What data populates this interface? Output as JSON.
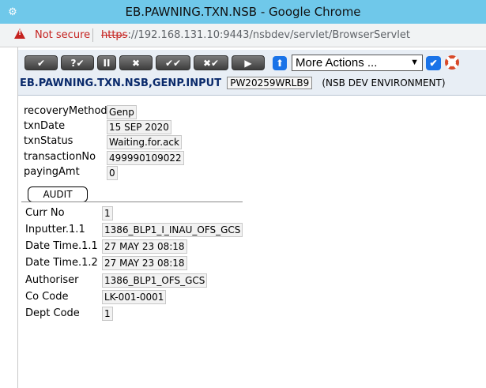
{
  "window": {
    "title": "EB.PAWNING.TXN.NSB - Google Chrome"
  },
  "address": {
    "security_text": "Not secure",
    "scheme": "https",
    "rest": "://192.168.131.10:9443/nsbdev/servlet/BrowserServlet"
  },
  "toolbar": {
    "buttons": [
      {
        "label": "✔"
      },
      {
        "label": "?✔"
      },
      {
        "label": "II"
      },
      {
        "label": "✖"
      },
      {
        "label": "✔✔"
      },
      {
        "label": "✖✔"
      },
      {
        "label": "▶"
      }
    ],
    "actions_selected": "More Actions ...",
    "version_name": "EB.PAWNING.TXN.NSB,GENP.INPUT",
    "txn_id": "PW20259WRLB9",
    "environment": "(NSB DEV ENVIRONMENT)"
  },
  "fields": [
    {
      "label": "recoveryMethod",
      "value": "Genp"
    },
    {
      "label": "txnDate",
      "value": "15 SEP 2020"
    },
    {
      "label": "txnStatus",
      "value": "Waiting.for.ack"
    },
    {
      "label": "transactionNo",
      "value": "499990109022"
    },
    {
      "label": "payingAmt",
      "value": "0"
    }
  ],
  "audit": {
    "tab_label": "AUDIT",
    "fields": [
      {
        "label": "Curr No",
        "value": "1"
      },
      {
        "label": "Inputter.1.1",
        "value": "1386_BLP1_I_INAU_OFS_GCS"
      },
      {
        "label": "Date Time.1.1",
        "value": "27 MAY 23 08:18"
      },
      {
        "label": "Date Time.1.2",
        "value": "27 MAY 23 08:18"
      },
      {
        "label": "Authoriser",
        "value": "1386_BLP1_OFS_GCS"
      },
      {
        "label": "Co Code",
        "value": "LK-001-0001"
      },
      {
        "label": "Dept Code",
        "value": "1"
      }
    ]
  }
}
